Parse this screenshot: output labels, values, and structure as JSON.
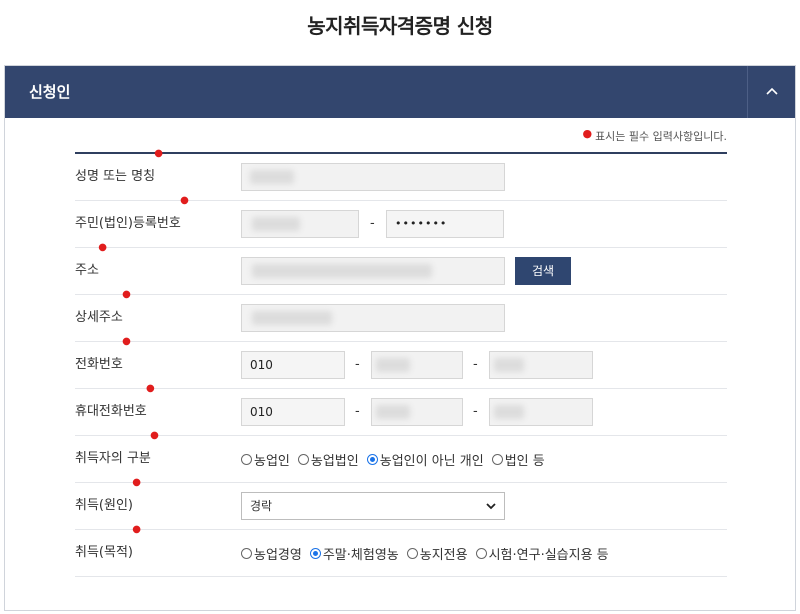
{
  "page": {
    "title": "농지취득자격증명 신청"
  },
  "section": {
    "title": "신청인",
    "toggle_icon": "chevron-up-icon"
  },
  "required_note": "표시는 필수 입력사항입니다.",
  "colors": {
    "header": "#33466e",
    "required": "#e11d1d",
    "button": "#2f4670",
    "radio_checked": "#1a73e8"
  },
  "form": {
    "name_label": "성명 또는 명칭",
    "reg_label": "주민(법인)등록번호",
    "reg_masked": "•••••••",
    "address_label": "주소",
    "search_button": "검색",
    "detail_label": "상세주소",
    "phone_label": "전화번호",
    "phone_prefix": "010",
    "mobile_label": "휴대전화번호",
    "mobile_prefix": "010",
    "dash": "-",
    "acq_type_label": "취득자의 구분",
    "acq_type_options": [
      "농업인",
      "농업법인",
      "농업인이 아닌 개인",
      "법인 등"
    ],
    "acq_type_selected": "농업인이 아닌 개인",
    "cause_label": "취득(원인)",
    "cause_value": "경락",
    "purpose_label": "취득(목적)",
    "purpose_options": [
      "농업경영",
      "주말·체험영농",
      "농지전용",
      "시험·연구·실습지용 등"
    ],
    "purpose_selected": "주말·체험영농"
  }
}
